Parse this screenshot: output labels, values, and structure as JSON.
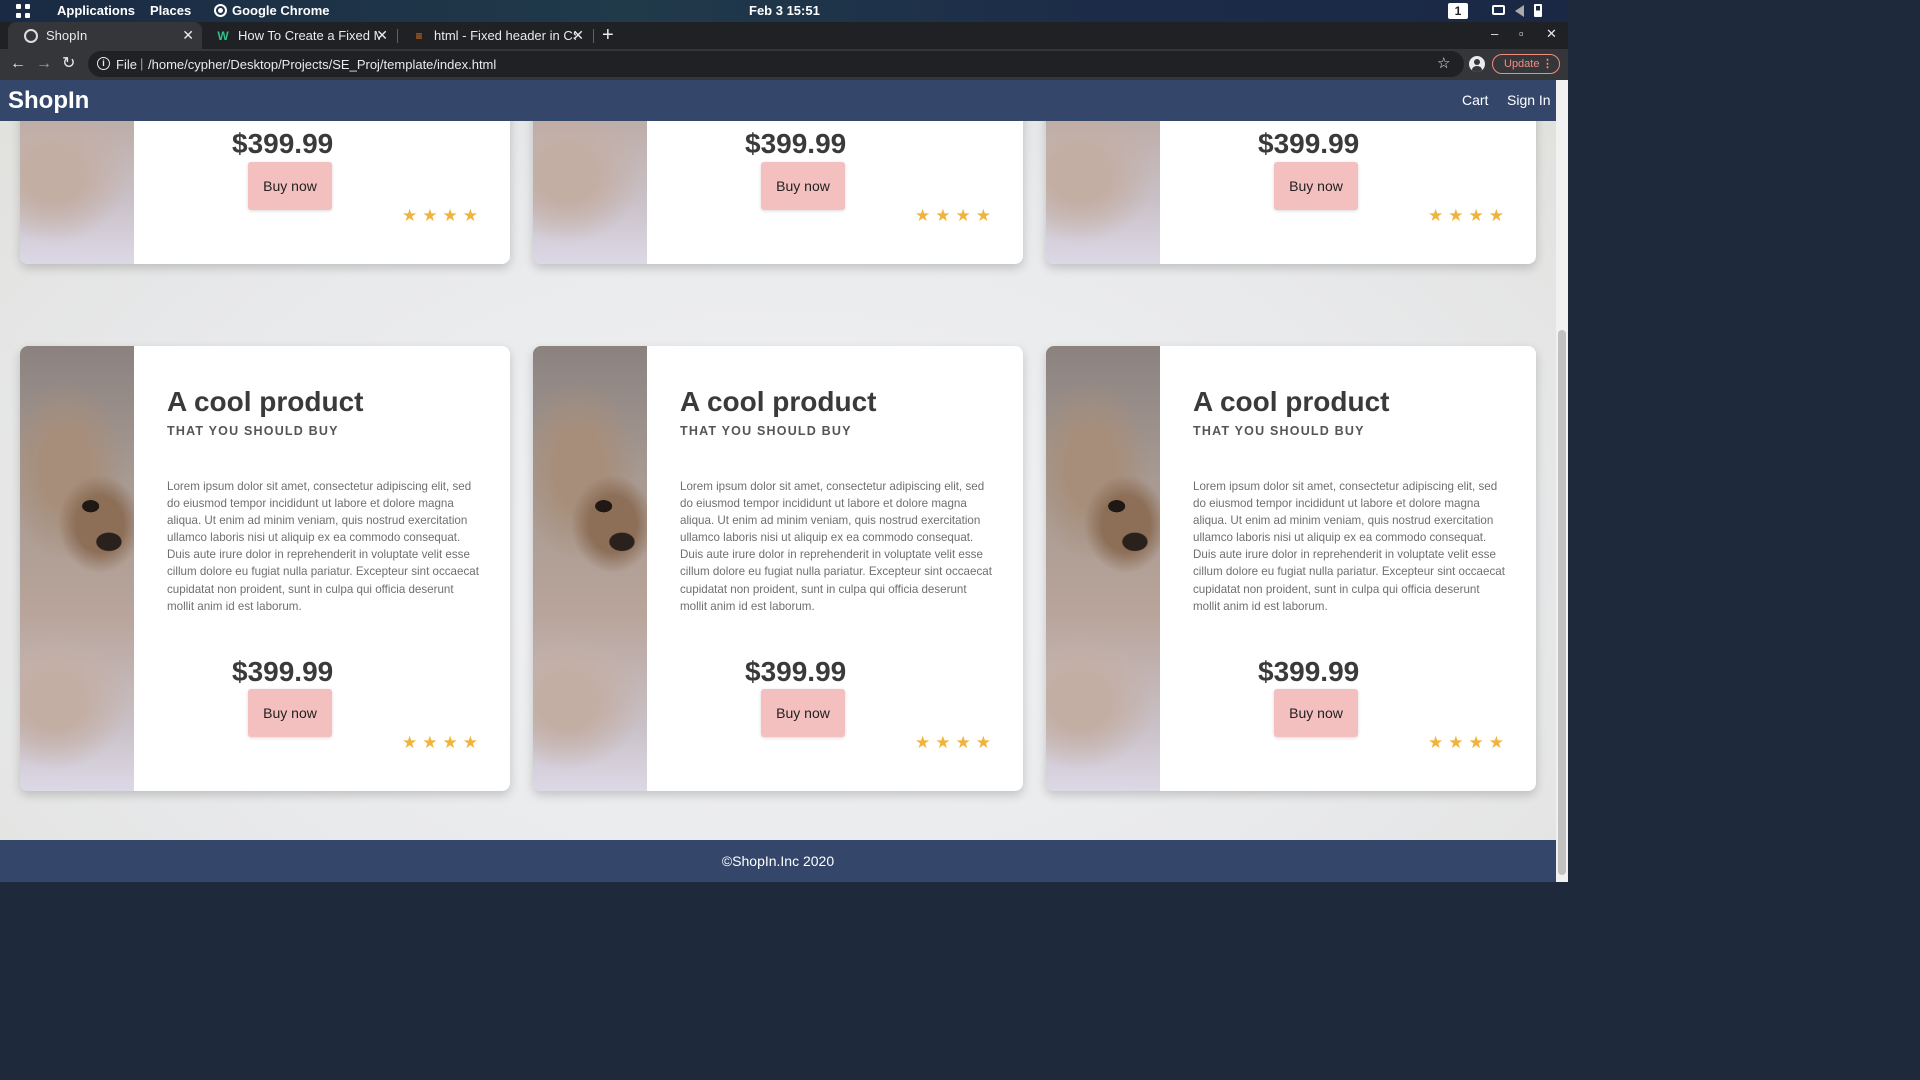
{
  "os_bar": {
    "applications": "Applications",
    "places": "Places",
    "app_name": "Google Chrome",
    "clock": "Feb 3  15:51",
    "workspace": "1"
  },
  "browser": {
    "tabs": [
      {
        "title": "ShopIn",
        "active": true,
        "favicon": "globe-icon"
      },
      {
        "title": "How To Create a Fixed Me",
        "active": false,
        "favicon": "w3schools-icon"
      },
      {
        "title": "html - Fixed header in CS",
        "active": false,
        "favicon": "stackoverflow-icon"
      }
    ],
    "new_tab": "+",
    "url_scheme": "File",
    "url": "/home/cypher/Desktop/Projects/SE_Proj/template/index.html",
    "update_label": "Update"
  },
  "site": {
    "brand": "ShopIn",
    "nav": {
      "cart": "Cart",
      "sign_in": "Sign In"
    },
    "footer": "©ShopIn.Inc 2020",
    "colors": {
      "header": "#34476b",
      "button": "#f4bfbf",
      "star": "#f0b43c"
    }
  },
  "product_template": {
    "title": "A cool product",
    "subtitle": "THAT YOU SHOULD BUY",
    "description": "Lorem ipsum dolor sit amet, consectetur adipiscing elit, sed do eiusmod tempor incididunt ut labore et dolore magna aliqua. Ut enim ad minim veniam, quis nostrud exercitation ullamco laboris nisi ut aliquip ex ea commodo consequat. Duis aute irure dolor in reprehenderit in voluptate velit esse cillum dolore eu fugiat nulla pariatur. Excepteur sint occaecat cupidatat non proident, sunt in culpa qui officia deserunt mollit anim id est laborum.",
    "price": "$399.99",
    "buy_label": "Buy now",
    "rating": 4
  },
  "product_rows": [
    {
      "cards": [
        {
          "price": "$399.99",
          "buy_label": "Buy now",
          "rating": 4
        },
        {
          "price": "$399.99",
          "buy_label": "Buy now",
          "rating": 4
        },
        {
          "price": "$399.99",
          "buy_label": "Buy now",
          "rating": 4
        }
      ]
    },
    {
      "cards": [
        {
          "title": "A cool product",
          "subtitle": "THAT YOU SHOULD BUY",
          "description": "Lorem ipsum dolor sit amet, consectetur adipiscing elit, sed do eiusmod tempor incididunt ut labore et dolore magna aliqua. Ut enim ad minim veniam, quis nostrud exercitation ullamco laboris nisi ut aliquip ex ea commodo consequat. Duis aute irure dolor in reprehenderit in voluptate velit esse cillum dolore eu fugiat nulla pariatur. Excepteur sint occaecat cupidatat non proident, sunt in culpa qui officia deserunt mollit anim id est laborum.",
          "price": "$399.99",
          "buy_label": "Buy now",
          "rating": 4
        },
        {
          "title": "A cool product",
          "subtitle": "THAT YOU SHOULD BUY",
          "description": "Lorem ipsum dolor sit amet, consectetur adipiscing elit, sed do eiusmod tempor incididunt ut labore et dolore magna aliqua. Ut enim ad minim veniam, quis nostrud exercitation ullamco laboris nisi ut aliquip ex ea commodo consequat. Duis aute irure dolor in reprehenderit in voluptate velit esse cillum dolore eu fugiat nulla pariatur. Excepteur sint occaecat cupidatat non proident, sunt in culpa qui officia deserunt mollit anim id est laborum.",
          "price": "$399.99",
          "buy_label": "Buy now",
          "rating": 4
        },
        {
          "title": "A cool product",
          "subtitle": "THAT YOU SHOULD BUY",
          "description": "Lorem ipsum dolor sit amet, consectetur adipiscing elit, sed do eiusmod tempor incididunt ut labore et dolore magna aliqua. Ut enim ad minim veniam, quis nostrud exercitation ullamco laboris nisi ut aliquip ex ea commodo consequat. Duis aute irure dolor in reprehenderit in voluptate velit esse cillum dolore eu fugiat nulla pariatur. Excepteur sint occaecat cupidatat non proident, sunt in culpa qui officia deserunt mollit anim id est laborum.",
          "price": "$399.99",
          "buy_label": "Buy now",
          "rating": 4
        }
      ]
    }
  ]
}
